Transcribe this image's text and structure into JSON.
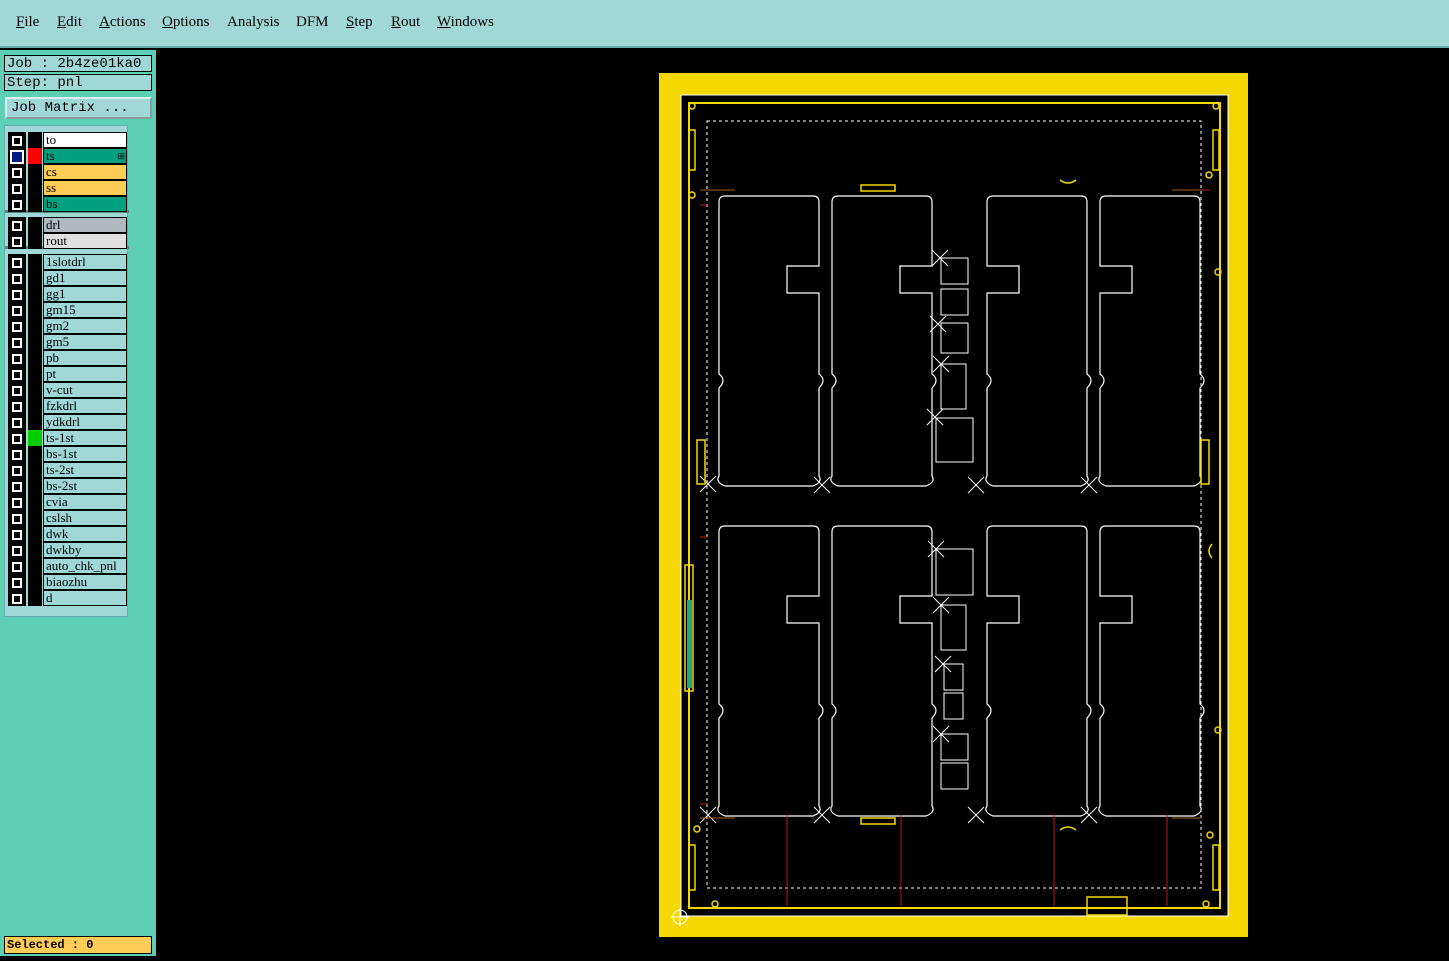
{
  "menubar": {
    "items": [
      {
        "label": "File",
        "ul": "F",
        "rest": "ile"
      },
      {
        "label": "Edit",
        "ul": "E",
        "rest": "dit"
      },
      {
        "label": "Actions",
        "ul": "A",
        "rest": "ctions"
      },
      {
        "label": "Options",
        "ul": "O",
        "rest": "ptions"
      },
      {
        "label": "Analysis",
        "ul": "",
        "rest": "Analysis"
      },
      {
        "label": "DFM",
        "ul": "",
        "rest": "DFM"
      },
      {
        "label": "Step",
        "ul": "S",
        "rest": "tep"
      },
      {
        "label": "Rout",
        "ul": "R",
        "rest": "out"
      },
      {
        "label": "Windows",
        "ul": "W",
        "rest": "indows"
      }
    ]
  },
  "job": {
    "label": "Job : 2b4ze01ka0"
  },
  "step": {
    "label": "Step: pnl"
  },
  "job_matrix_button": "Job Matrix ...",
  "layers": [
    {
      "name": "to",
      "color": "#ffffff",
      "checked": false,
      "mark": ""
    },
    {
      "name": "ts",
      "color": "#009f7f",
      "checked": true,
      "mark": "#ff0000",
      "extra": "⊞"
    },
    {
      "name": "cs",
      "color": "#ffcc55",
      "checked": false,
      "mark": ""
    },
    {
      "name": "ss",
      "color": "#ffcc55",
      "checked": false,
      "mark": ""
    },
    {
      "name": "bs",
      "color": "#009f7f",
      "checked": false,
      "mark": ""
    },
    {
      "name": "drl",
      "color": "#b0b8c0",
      "checked": false,
      "mark": ""
    },
    {
      "name": "rout",
      "color": "#e0e0e0",
      "checked": false,
      "mark": ""
    },
    {
      "name": "1slotdrl",
      "color": "#a0d8d8",
      "checked": false,
      "mark": ""
    },
    {
      "name": "gd1",
      "color": "#a0d8d8",
      "checked": false,
      "mark": ""
    },
    {
      "name": "gg1",
      "color": "#a0d8d8",
      "checked": false,
      "mark": ""
    },
    {
      "name": "gm15",
      "color": "#a0d8d8",
      "checked": false,
      "mark": ""
    },
    {
      "name": "gm2",
      "color": "#a0d8d8",
      "checked": false,
      "mark": ""
    },
    {
      "name": "gm5",
      "color": "#a0d8d8",
      "checked": false,
      "mark": ""
    },
    {
      "name": "pb",
      "color": "#a0d8d8",
      "checked": false,
      "mark": ""
    },
    {
      "name": "pt",
      "color": "#a0d8d8",
      "checked": false,
      "mark": ""
    },
    {
      "name": "v-cut",
      "color": "#a0d8d8",
      "checked": false,
      "mark": ""
    },
    {
      "name": "fzkdrl",
      "color": "#a0d8d8",
      "checked": false,
      "mark": ""
    },
    {
      "name": "ydkdrl",
      "color": "#a0d8d8",
      "checked": false,
      "mark": ""
    },
    {
      "name": "ts-1st",
      "color": "#a0d8d8",
      "checked": false,
      "mark": "#00cc00"
    },
    {
      "name": "bs-1st",
      "color": "#a0d8d8",
      "checked": false,
      "mark": ""
    },
    {
      "name": "ts-2st",
      "color": "#a0d8d8",
      "checked": false,
      "mark": ""
    },
    {
      "name": "bs-2st",
      "color": "#a0d8d8",
      "checked": false,
      "mark": ""
    },
    {
      "name": "cvia",
      "color": "#a0d8d8",
      "checked": false,
      "mark": ""
    },
    {
      "name": "cslsh",
      "color": "#a0d8d8",
      "checked": false,
      "mark": ""
    },
    {
      "name": "dwk",
      "color": "#a0d8d8",
      "checked": false,
      "mark": ""
    },
    {
      "name": "dwkby",
      "color": "#a0d8d8",
      "checked": false,
      "mark": ""
    },
    {
      "name": "auto_chk_pnl",
      "color": "#a0d8d8",
      "checked": false,
      "mark": ""
    },
    {
      "name": "biaozhu",
      "color": "#a0d8d8",
      "checked": false,
      "mark": ""
    },
    {
      "name": "d",
      "color": "#a0d8d8",
      "checked": false,
      "mark": ""
    }
  ],
  "status": {
    "selected": "Selected : 0"
  },
  "colors": {
    "panel_frame": "#f5d800",
    "board_outline": "#ffffff",
    "rout_line": "#c01818",
    "background": "#000000"
  }
}
